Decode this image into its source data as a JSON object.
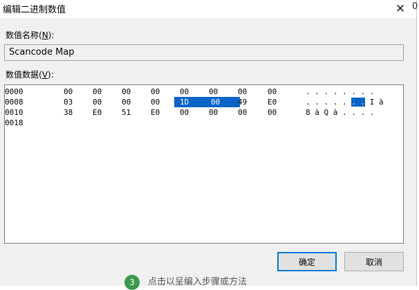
{
  "window": {
    "title": "编辑二进制数值",
    "close_glyph": "✕",
    "edge_text": "0"
  },
  "value_name": {
    "label": "数值名称(",
    "accel": "N",
    "label_suffix": "):",
    "value": "Scancode Map"
  },
  "value_data": {
    "label": "数值数据(",
    "accel": "V",
    "label_suffix": "):",
    "rows": [
      {
        "addr": "0000",
        "bytes": [
          "00",
          "00",
          "00",
          "00",
          "00",
          "00",
          "00",
          "00"
        ],
        "ascii": ". . . . . . . ."
      },
      {
        "addr": "0008",
        "bytes": [
          "03",
          "00",
          "00",
          "00",
          "1D",
          "00",
          "49",
          "E0"
        ],
        "ascii_pre": ". . . . . ",
        "ascii_sel": ". .",
        "ascii_post": " I à"
      },
      {
        "addr": "0010",
        "bytes": [
          "38",
          "E0",
          "51",
          "E0",
          "00",
          "00",
          "00",
          "00"
        ],
        "ascii": "8 à Q à . . . ."
      },
      {
        "addr": "0018",
        "bytes": [],
        "ascii": ""
      }
    ]
  },
  "buttons": {
    "ok": "确定",
    "cancel": "取消"
  },
  "background_footer": {
    "step": "3",
    "text": "点击以呈编入步骤或方法"
  }
}
